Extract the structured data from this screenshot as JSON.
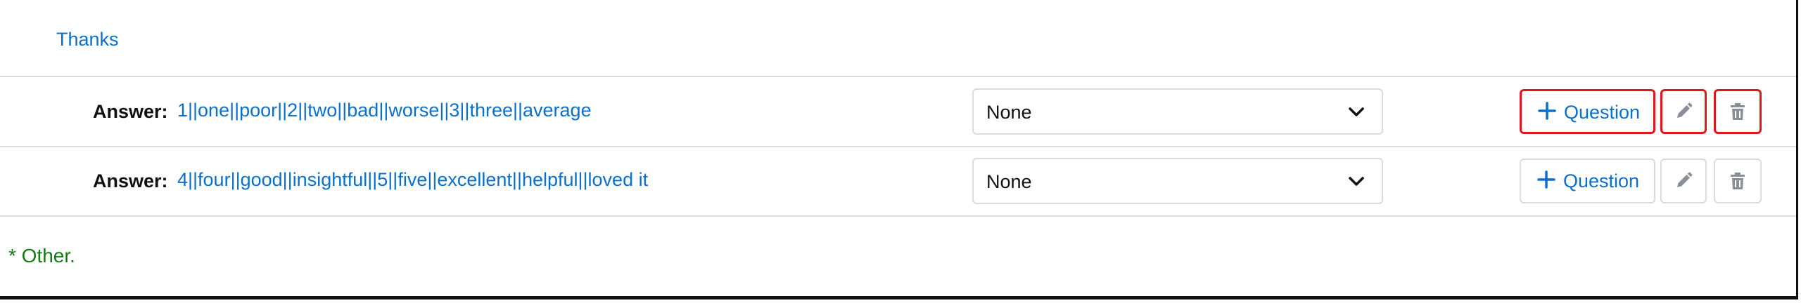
{
  "section": {
    "title": "Thanks"
  },
  "answers": [
    {
      "label": "Answer:",
      "text": "1||one||poor||2||two||bad||worse||3||three||average",
      "select_value": "None",
      "add_question_label": "Question"
    },
    {
      "label": "Answer:",
      "text": "4||four||good||insightful||5||five||excellent||helpful||loved it",
      "select_value": "None",
      "add_question_label": "Question"
    }
  ],
  "footer": {
    "note": "* Other."
  },
  "colors": {
    "link": "#0b70c9",
    "highlight_border": "#e0171f",
    "note_green": "#137a13",
    "icon_gray": "#8a8f98"
  }
}
